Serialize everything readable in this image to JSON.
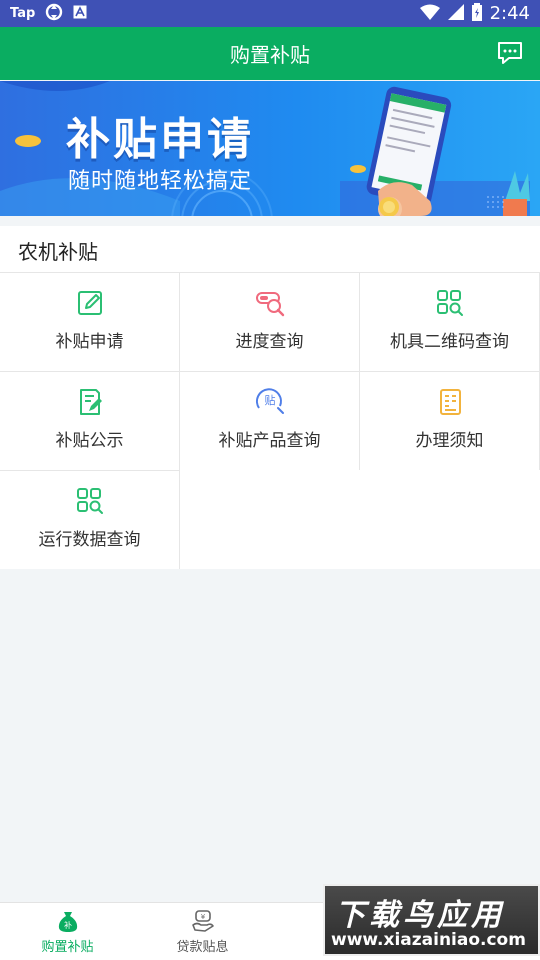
{
  "status_bar": {
    "app_label": "Tap",
    "time": "2:44"
  },
  "header": {
    "title": "购置补贴",
    "message_icon": "chat-icon"
  },
  "banner": {
    "title": "补贴申请",
    "subtitle": "随时随地轻松搞定"
  },
  "section": {
    "title": "农机补贴",
    "items": [
      {
        "label": "补贴申请",
        "icon": "edit-icon",
        "color": "#2bbf73"
      },
      {
        "label": "进度查询",
        "icon": "progress-search-icon",
        "color": "#f06a7d"
      },
      {
        "label": "机具二维码查询",
        "icon": "grid-search-icon",
        "color": "#2bbf73"
      },
      {
        "label": "补贴公示",
        "icon": "notice-icon",
        "color": "#2bbf73"
      },
      {
        "label": "补贴产品查询",
        "icon": "product-search-icon",
        "color": "#4f7ee8"
      },
      {
        "label": "办理须知",
        "icon": "document-icon",
        "color": "#f2b33d"
      },
      {
        "label": "运行数据查询",
        "icon": "grid-search-icon",
        "color": "#2bbf73"
      }
    ]
  },
  "bottom_nav": {
    "items": [
      {
        "label": "购置补贴",
        "icon": "subsidy-bag-icon",
        "active": true
      },
      {
        "label": "贷款贴息",
        "icon": "loan-icon",
        "active": false
      }
    ],
    "active_color": "#0aad61",
    "inactive_color": "#555555"
  },
  "watermark": {
    "line1": "下载鸟应用",
    "line2": "www.xiazainiao.com"
  }
}
